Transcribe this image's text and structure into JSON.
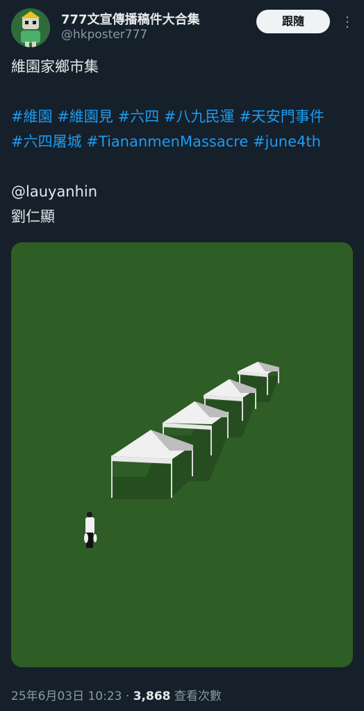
{
  "author": {
    "name": "777文宣傳播稿件大合集",
    "handle": "@hkposter777"
  },
  "follow_label": "跟隨",
  "more_label": "⋮",
  "post": {
    "title_line": "維園家鄉市集",
    "tags_line1": [
      "#維園",
      "#維園見",
      "#六四",
      "#八九民運",
      "#天安門事件"
    ],
    "tags_line2": [
      "#六四屠城",
      "#TiananmenMassacre",
      "#june4th"
    ],
    "mention": "@lauyanhin",
    "signature": "劉仁顯"
  },
  "meta": {
    "datetime": "25年6月03日 10:23",
    "separator": "·",
    "views_count": "3,868",
    "views_label": "查看次數"
  },
  "colors": {
    "background": "#15202b",
    "link": "#1d9bf0",
    "muted": "#8b98a5",
    "grass": "#2e5d25"
  }
}
